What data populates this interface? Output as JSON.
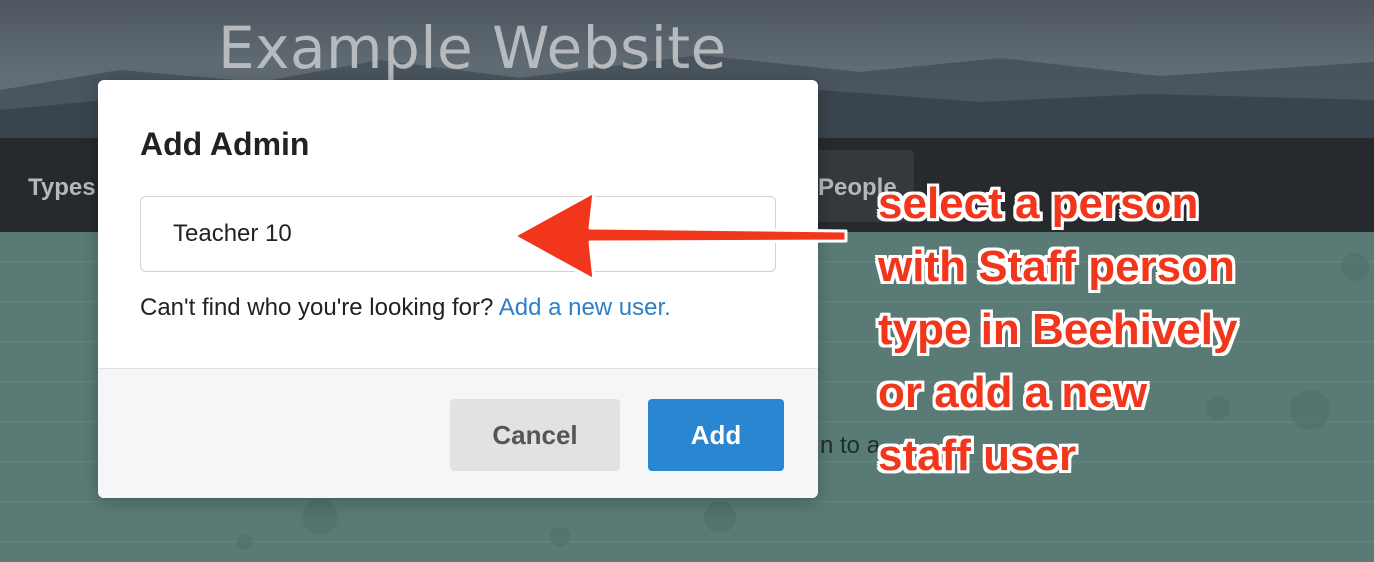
{
  "background": {
    "site_title": "Example Website",
    "nav_types": "Types",
    "nav_people": "People",
    "content_snippet": "n to a"
  },
  "modal": {
    "title": "Add Admin",
    "input_value": "Teacher 10",
    "help_text": "Can't find who you're looking for?",
    "help_link": "Add a new user.",
    "cancel_label": "Cancel",
    "add_label": "Add"
  },
  "annotation": {
    "lines": [
      "select a person",
      "with Staff person",
      "type in Beehively",
      "or add a new",
      "staff user"
    ]
  },
  "colors": {
    "primary_button": "#2b86d1",
    "link": "#2f7fc7",
    "annotation": "#f2361c"
  }
}
